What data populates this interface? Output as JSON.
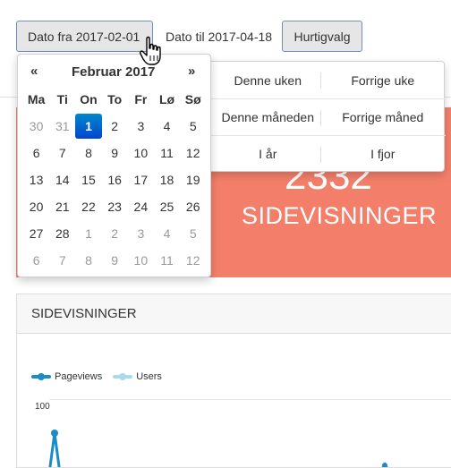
{
  "toolbar": {
    "from_label": "Dato fra 2017-02-01",
    "to_label": "Dato til 2017-04-18",
    "quick_label": "Hurtigvalg"
  },
  "quick_menu": {
    "rows": [
      [
        "Denne uken",
        "Forrige uke"
      ],
      [
        "Denne måneden",
        "Forrige måned"
      ],
      [
        "I år",
        "I fjor"
      ]
    ]
  },
  "calendar": {
    "prev": "«",
    "next": "»",
    "month_label": "Februar 2017",
    "weekdays": [
      "Ma",
      "Ti",
      "On",
      "To",
      "Fr",
      "Lø",
      "Sø"
    ],
    "weeks": [
      [
        {
          "d": "30",
          "m": true
        },
        {
          "d": "31",
          "m": true
        },
        {
          "d": "1",
          "s": true
        },
        {
          "d": "2"
        },
        {
          "d": "3"
        },
        {
          "d": "4"
        },
        {
          "d": "5"
        }
      ],
      [
        {
          "d": "6"
        },
        {
          "d": "7"
        },
        {
          "d": "8"
        },
        {
          "d": "9"
        },
        {
          "d": "10"
        },
        {
          "d": "11"
        },
        {
          "d": "12"
        }
      ],
      [
        {
          "d": "13"
        },
        {
          "d": "14"
        },
        {
          "d": "15"
        },
        {
          "d": "16"
        },
        {
          "d": "17"
        },
        {
          "d": "18"
        },
        {
          "d": "19"
        }
      ],
      [
        {
          "d": "20"
        },
        {
          "d": "21"
        },
        {
          "d": "22"
        },
        {
          "d": "23"
        },
        {
          "d": "24"
        },
        {
          "d": "25"
        },
        {
          "d": "26"
        }
      ],
      [
        {
          "d": "27"
        },
        {
          "d": "28"
        },
        {
          "d": "1",
          "m": true
        },
        {
          "d": "2",
          "m": true
        },
        {
          "d": "3",
          "m": true
        },
        {
          "d": "4",
          "m": true
        },
        {
          "d": "5",
          "m": true
        }
      ],
      [
        {
          "d": "6",
          "m": true
        },
        {
          "d": "7",
          "m": true
        },
        {
          "d": "8",
          "m": true
        },
        {
          "d": "9",
          "m": true
        },
        {
          "d": "10",
          "m": true
        },
        {
          "d": "11",
          "m": true
        },
        {
          "d": "12",
          "m": true
        }
      ]
    ]
  },
  "hero": {
    "number": "2332",
    "label": "SIDEVISNINGER",
    "color": "#f37f6b"
  },
  "panel": {
    "title": "SIDEVISNINGER",
    "legend": [
      {
        "name": "Pageviews",
        "color": "#1a8cc7"
      },
      {
        "name": "Users",
        "color": "#a9d9f0"
      }
    ],
    "y_tick": "100"
  },
  "colors": {
    "accent": "#0066cc",
    "button_border": "#6f8fc4"
  }
}
